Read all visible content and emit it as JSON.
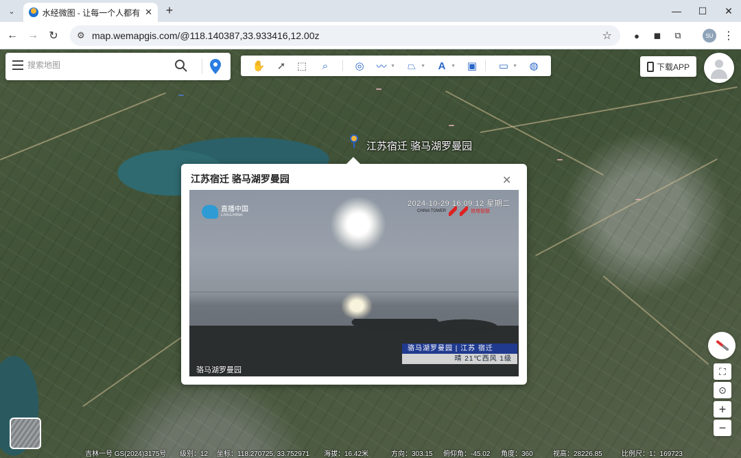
{
  "browser": {
    "tab_title": "水经微图 - 让每一个人都有自己",
    "url": "map.wemapgis.com/@118.140387,33.933416,12.00z",
    "profile_initials": "SU"
  },
  "search": {
    "placeholder": "搜索地图"
  },
  "header": {
    "download_label": "下载APP"
  },
  "map": {
    "poi_label": "江苏宿迁 骆马湖罗曼园"
  },
  "popup": {
    "title": "江苏宿迁 骆马湖罗曼园",
    "video": {
      "brand": "直播中国",
      "brand_sub": "LIVECHINA",
      "timestamp": "2024-10-29 16:09:12 星期二",
      "partner1": "CHINA TOWER",
      "partner2": "铁塔智联",
      "caption_line1": "骆马湖罗曼园 | 江苏 宿迁",
      "caption_line2": "晴 21℃西风 1级",
      "location_name": "骆马湖罗曼园"
    }
  },
  "statusbar": {
    "source": "吉林一号 GS(2024)3175号",
    "level": "级别：12",
    "coords": "坐标：118.270725, 33.752971",
    "altitude": "海拔：16.42米",
    "heading": "方向：303.15",
    "pitch": "俯仰角：-45.02",
    "angle": "角度：360",
    "view_height": "视高：28226.85",
    "scale": "比例尺：1：169723"
  },
  "icons": {
    "accent": "#2a66c8"
  }
}
